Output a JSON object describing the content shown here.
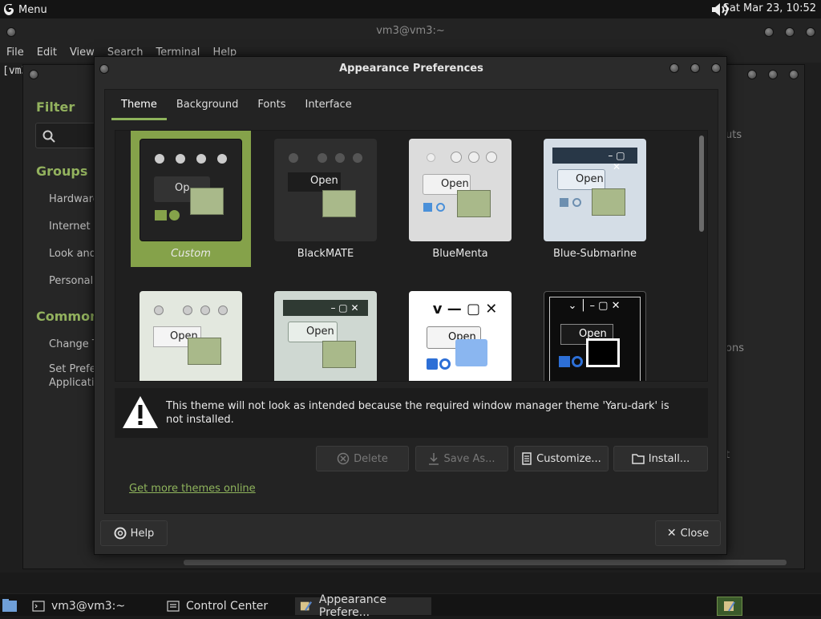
{
  "top_panel": {
    "menu_label": "Menu",
    "clock": "Sat Mar 23, 10:52"
  },
  "terminal": {
    "title": "vm3@vm3:~",
    "menus": [
      "File",
      "Edit",
      "View",
      "Search",
      "Terminal",
      "Help"
    ],
    "prompt": "[vm3"
  },
  "control_center": {
    "filter_heading": "Filter",
    "groups_heading": "Groups",
    "groups": [
      "Hardware",
      "Internet a",
      "Look and",
      "Personal"
    ],
    "common_heading": "Common T",
    "common": [
      "Change T",
      "Set Prefe",
      "Applicati"
    ],
    "right_fragments": [
      "uts",
      "ons",
      "t"
    ]
  },
  "dialog": {
    "title": "Appearance Preferences",
    "tabs": [
      "Theme",
      "Background",
      "Fonts",
      "Interface"
    ],
    "active_tab": "Theme",
    "themes": [
      {
        "name": "Custom",
        "preview_text": "Op",
        "selected": true
      },
      {
        "name": "BlackMATE",
        "preview_text": "Open"
      },
      {
        "name": "BlueMenta",
        "preview_text": "Open"
      },
      {
        "name": "Blue-Submarine",
        "preview_text": "Open"
      },
      {
        "name": "",
        "preview_text": "Open"
      },
      {
        "name": "",
        "preview_text": "Open"
      },
      {
        "name": "",
        "preview_text": "Open"
      },
      {
        "name": "",
        "preview_text": "Open"
      }
    ],
    "warning": "This theme will not look as intended because the required window manager theme 'Yaru-dark' is not installed.",
    "buttons": {
      "delete": "Delete",
      "save_as": "Save As...",
      "customize": "Customize...",
      "install": "Install..."
    },
    "more_themes_link": "Get more themes online",
    "help_button": "Help",
    "close_button": "Close"
  },
  "taskbar": {
    "items": [
      "vm3@vm3:~",
      "Control Center",
      "Appearance Prefere..."
    ]
  },
  "colors": {
    "accent": "#85a24a",
    "link": "#8fb45c",
    "panel": "#141414"
  }
}
